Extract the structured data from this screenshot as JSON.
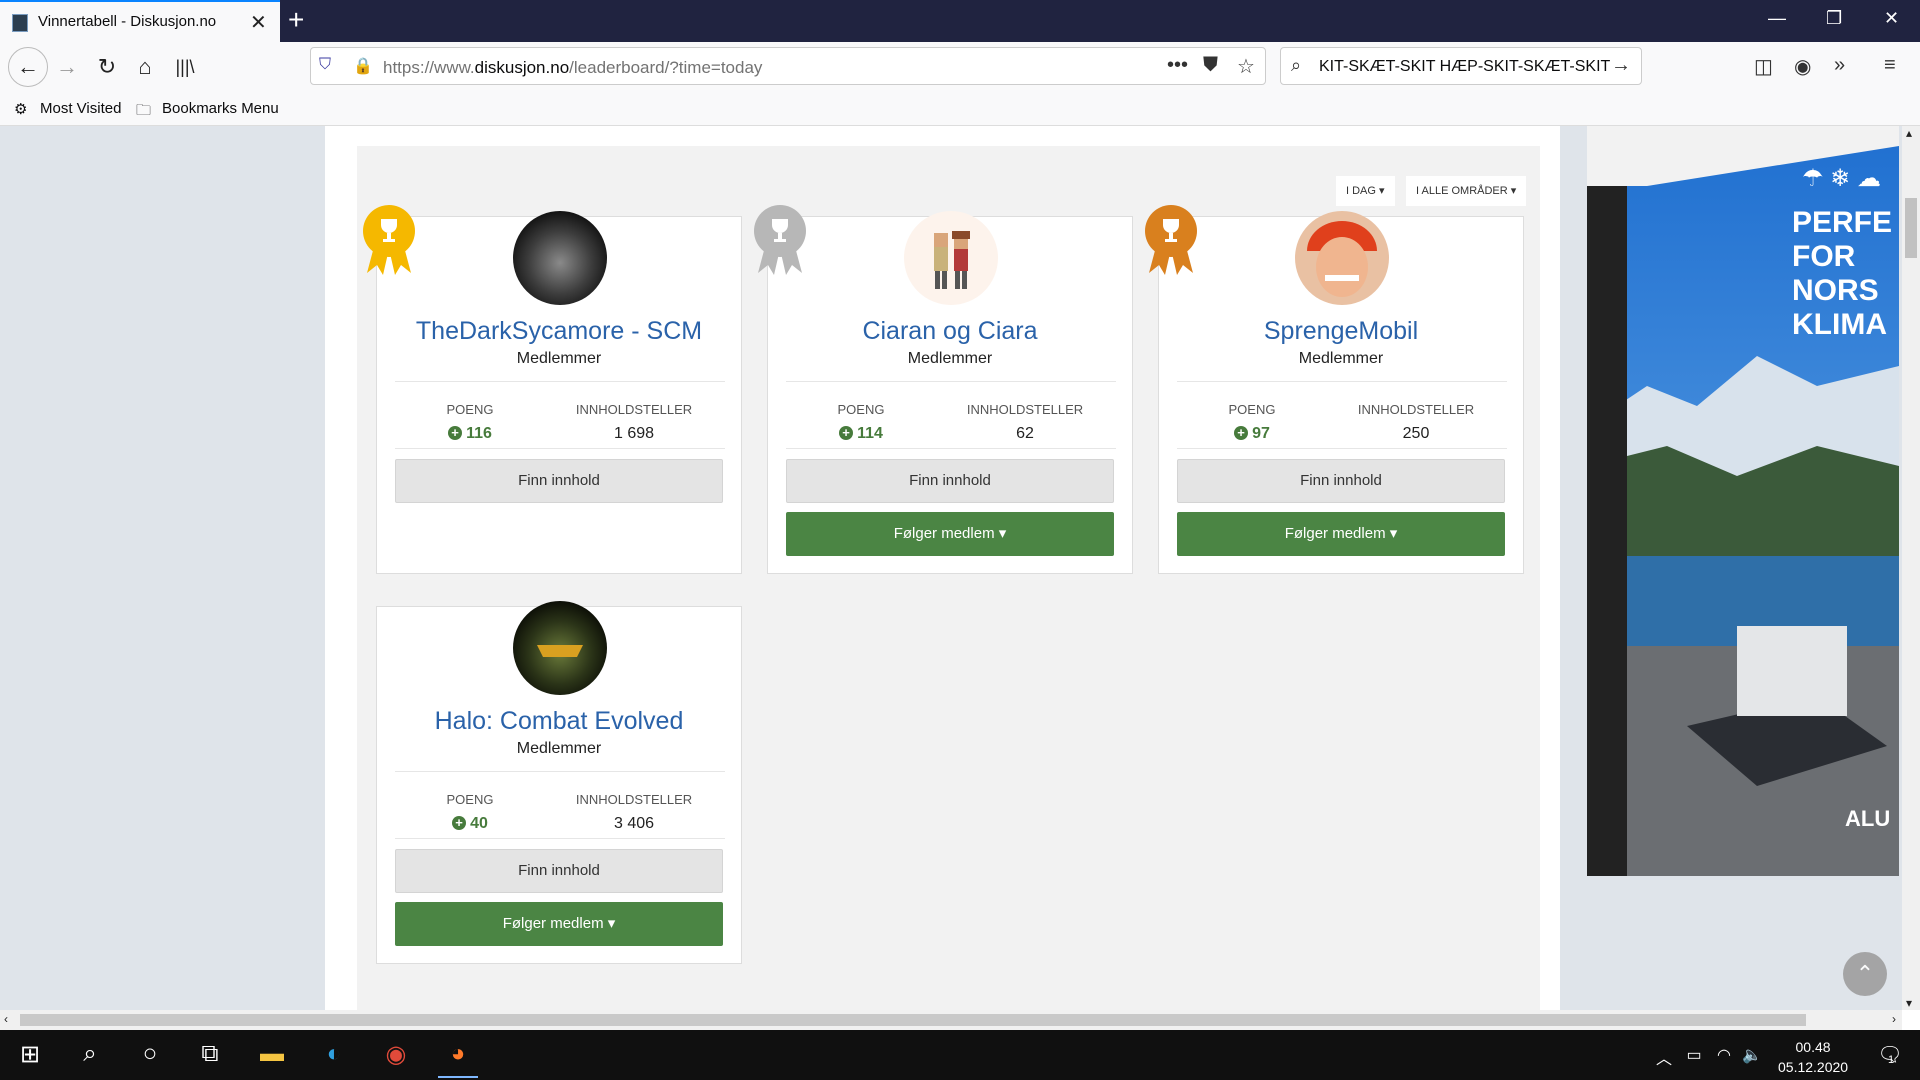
{
  "browser": {
    "tab_title": "Vinnertabell - Diskusjon.no",
    "url_prefix": "https://www.",
    "url_domain": "diskusjon.no",
    "url_path": "/leaderboard/?time=today",
    "search_text": "KIT-SKÆT-SKIT HÆP-SKIT-SKÆT-SKIT",
    "bookmarks": [
      "Most Visited",
      "Bookmarks Menu"
    ]
  },
  "filters": {
    "time": "I DAG",
    "area": "I ALLE OMRÅDER"
  },
  "labels": {
    "points": "POENG",
    "content": "INNHOLDSTELLER",
    "find": "Finn innhold",
    "follow": "Følger medlem"
  },
  "members": [
    {
      "name": "TheDarkSycamore - SCM",
      "group": "Medlemmer",
      "points": "116",
      "content": "1 698",
      "rank": "gold",
      "following": false
    },
    {
      "name": "Ciaran og Ciara",
      "group": "Medlemmer",
      "points": "114",
      "content": "62",
      "rank": "silver",
      "following": true
    },
    {
      "name": "SprengeMobil",
      "group": "Medlemmer",
      "points": "97",
      "content": "250",
      "rank": "bronze",
      "following": true
    },
    {
      "name": "Halo: Combat Evolved",
      "group": "Medlemmer",
      "points": "40",
      "content": "3 406",
      "rank": "",
      "following": true
    }
  ],
  "ad": {
    "text_lines": [
      "PERFE",
      "FOR",
      "NORS",
      "KLIMA"
    ],
    "brand": "ALU"
  },
  "taskbar": {
    "time": "00.48",
    "date": "05.12.2020",
    "notifications": "1"
  },
  "colors": {
    "gold": "#f5b800",
    "silver": "#b7b7b7",
    "bronze": "#d9801e",
    "name": "#2a62a9",
    "follow_btn": "#4b8544"
  }
}
